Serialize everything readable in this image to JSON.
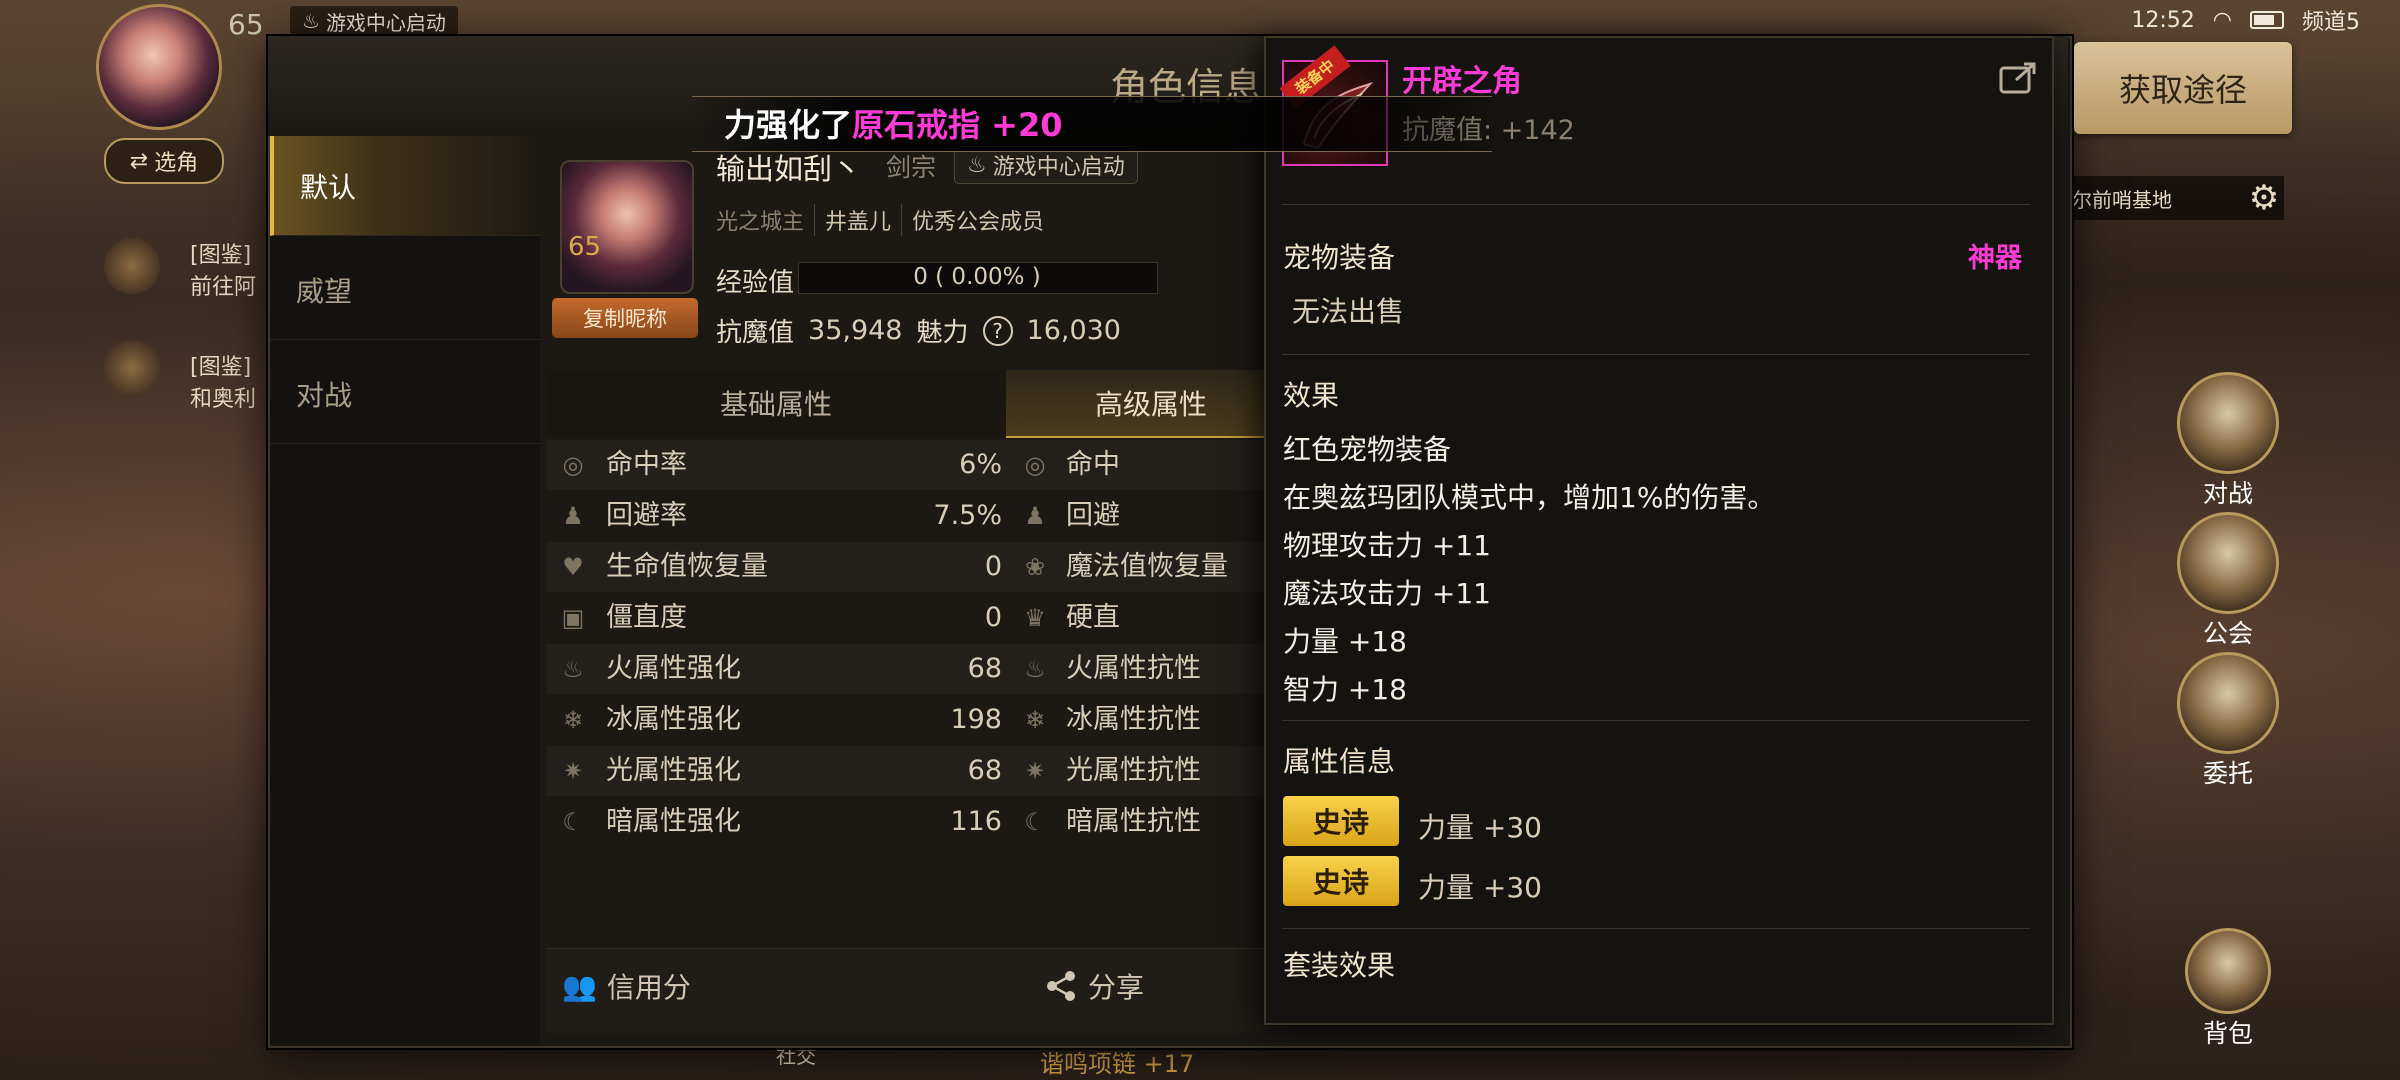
{
  "status_bar": {
    "time": "12:52",
    "channel": "频道5"
  },
  "hud": {
    "level": "65",
    "game_center": "游戏中心启动",
    "switch_role": "选角",
    "quests": [
      {
        "tag": "[图鉴]",
        "text": "前往阿"
      },
      {
        "tag": "[图鉴]",
        "text": "和奥利"
      }
    ],
    "map_name": "尔前哨基地",
    "side_buttons": [
      "对战",
      "公会",
      "委托",
      "背包"
    ],
    "bottom_item": "谐鸣项链 +17",
    "social": "社交"
  },
  "dialog": {
    "title": "角色信息",
    "side_tabs": [
      {
        "label": "默认",
        "active": true
      },
      {
        "label": "威望",
        "active": false
      },
      {
        "label": "对战",
        "active": false
      }
    ],
    "profile": {
      "level": "65",
      "copy_nickname": "复制昵称",
      "name": "输出如刮丶",
      "class": "剑宗",
      "game_center": "游戏中心启动",
      "server": "光之城主",
      "guild": "井盖儿",
      "guild_rank": "优秀公会成员",
      "exp_label": "经验值",
      "exp_value": "0 ( 0.00% )",
      "exp_fraction": 0.0,
      "anti_magic_label": "抗魔值",
      "anti_magic_value": "35,948",
      "charm_label": "魅力",
      "charm_value": "16,030"
    },
    "attr_tabs": {
      "basic": "基础属性",
      "advanced": "高级属性"
    },
    "attributes": [
      {
        "icon": "target-icon",
        "label": "命中率",
        "value": "6%",
        "label2": "命中"
      },
      {
        "icon": "dodge-icon",
        "label": "回避率",
        "value": "7.5%",
        "label2": "回避"
      },
      {
        "icon": "heart-icon",
        "label": "生命值恢复量",
        "value": "0",
        "label2": "魔法值恢复量"
      },
      {
        "icon": "stiff-icon",
        "label": "僵直度",
        "value": "0",
        "label2": "硬直"
      },
      {
        "icon": "fire-icon",
        "label": "火属性强化",
        "value": "68",
        "label2": "火属性抗性"
      },
      {
        "icon": "ice-icon",
        "label": "冰属性强化",
        "value": "198",
        "label2": "冰属性抗性"
      },
      {
        "icon": "light-icon",
        "label": "光属性强化",
        "value": "68",
        "label2": "光属性抗性"
      },
      {
        "icon": "dark-icon",
        "label": "暗属性强化",
        "value": "116",
        "label2": "暗属性抗性"
      }
    ],
    "bottom": {
      "credit": "信用分",
      "share": "分享"
    }
  },
  "toast": {
    "prefix": "力强化了",
    "item": "原石戒指 +20"
  },
  "tooltip": {
    "badge": "装备中",
    "name": "开辟之角",
    "anti_magic": "抗魔值: +142",
    "category": "宠物装备",
    "grade": "神器",
    "tradability": "无法出售",
    "effects_title": "效果",
    "effects": [
      "红色宠物装备",
      "在奥兹玛团队模式中，增加1%的伤害。",
      "物理攻击力 +11",
      "魔法攻击力 +11",
      "力量 +18",
      "智力 +18"
    ],
    "attr_info_title": "属性信息",
    "attr_info": [
      {
        "tag": "史诗",
        "value": "力量 +30"
      },
      {
        "tag": "史诗",
        "value": "力量 +30"
      }
    ],
    "set_effect_title": "套装效果",
    "colors": {
      "name": "#ff3ad6",
      "epic": "#f0c232"
    }
  },
  "acquire_button": "获取途径"
}
